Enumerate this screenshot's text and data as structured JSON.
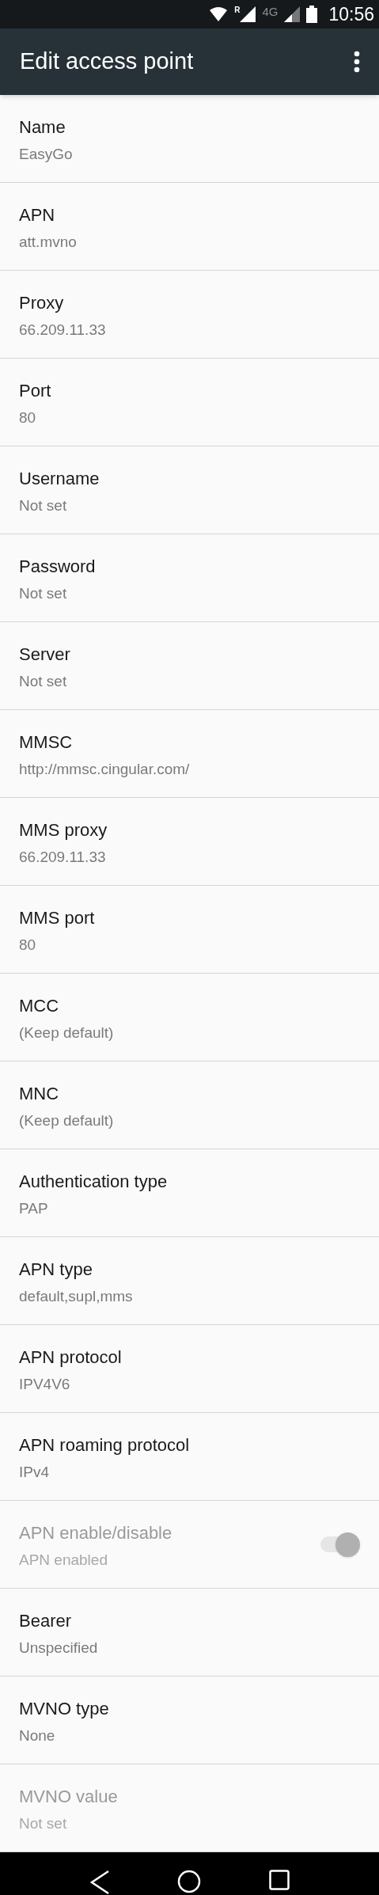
{
  "status_bar": {
    "roaming_label": "R",
    "network_label": "4G",
    "time": "10:56"
  },
  "toolbar": {
    "title": "Edit access point"
  },
  "items": [
    {
      "kind": "text",
      "title": "Name",
      "value": "EasyGo",
      "disabled": false
    },
    {
      "kind": "text",
      "title": "APN",
      "value": "att.mvno",
      "disabled": false
    },
    {
      "kind": "text",
      "title": "Proxy",
      "value": "66.209.11.33",
      "disabled": false
    },
    {
      "kind": "text",
      "title": "Port",
      "value": "80",
      "disabled": false
    },
    {
      "kind": "text",
      "title": "Username",
      "value": "Not set",
      "disabled": false
    },
    {
      "kind": "text",
      "title": "Password",
      "value": "Not set",
      "disabled": false
    },
    {
      "kind": "text",
      "title": "Server",
      "value": "Not set",
      "disabled": false
    },
    {
      "kind": "text",
      "title": "MMSC",
      "value": "http://mmsc.cingular.com/",
      "disabled": false
    },
    {
      "kind": "text",
      "title": "MMS proxy",
      "value": "66.209.11.33",
      "disabled": false
    },
    {
      "kind": "text",
      "title": "MMS port",
      "value": "80",
      "disabled": false
    },
    {
      "kind": "text",
      "title": "MCC",
      "value": "(Keep default)",
      "disabled": false
    },
    {
      "kind": "text",
      "title": "MNC",
      "value": "(Keep default)",
      "disabled": false
    },
    {
      "kind": "text",
      "title": "Authentication type",
      "value": "PAP",
      "disabled": false
    },
    {
      "kind": "text",
      "title": "APN type",
      "value": "default,supl,mms",
      "disabled": false
    },
    {
      "kind": "text",
      "title": "APN protocol",
      "value": "IPV4V6",
      "disabled": false
    },
    {
      "kind": "text",
      "title": "APN roaming protocol",
      "value": "IPv4",
      "disabled": false
    },
    {
      "kind": "switch",
      "title": "APN enable/disable",
      "value": "APN enabled",
      "disabled": true,
      "on": true
    },
    {
      "kind": "text",
      "title": "Bearer",
      "value": "Unspecified",
      "disabled": false
    },
    {
      "kind": "text",
      "title": "MVNO type",
      "value": "None",
      "disabled": false
    },
    {
      "kind": "text",
      "title": "MVNO value",
      "value": "Not set",
      "disabled": true
    }
  ]
}
